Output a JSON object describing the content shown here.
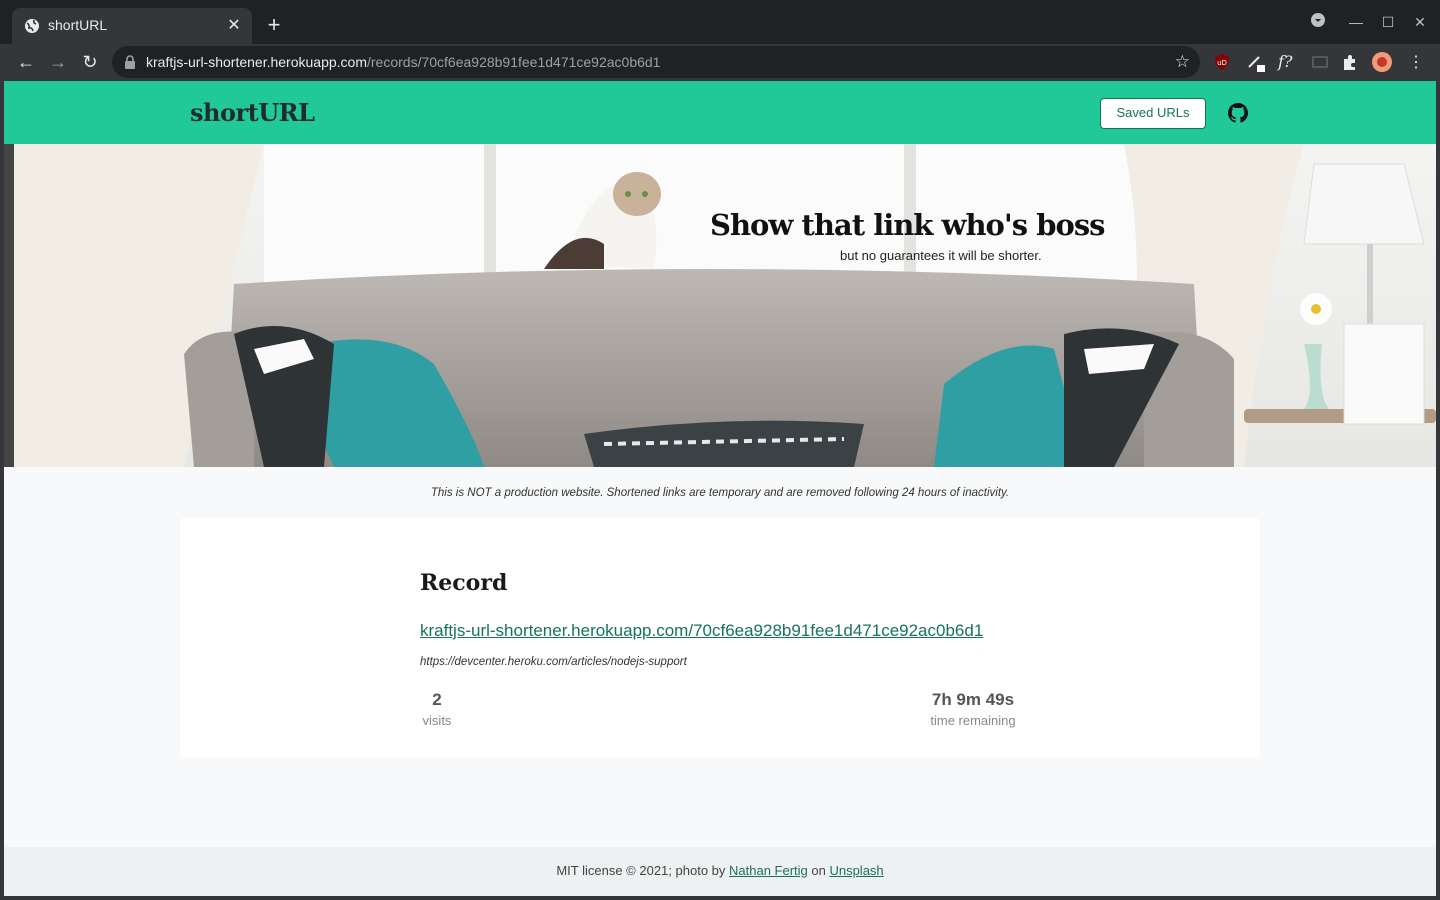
{
  "browser": {
    "tab_title": "shortURL",
    "url_host": "kraftjs-url-shortener.herokuapp.com",
    "url_path": "/records/70cf6ea928b91fee1d471ce92ac0b6d1"
  },
  "header": {
    "brand": "shortURL",
    "saved_label": "Saved URLs"
  },
  "hero": {
    "title": "Show that link who's boss",
    "subtitle": "but no guarantees it will be shorter."
  },
  "notice": "This is NOT a production website. Shortened links are temporary and are removed following 24 hours of inactivity.",
  "record": {
    "heading": "Record",
    "short_url": "kraftjs-url-shortener.herokuapp.com/70cf6ea928b91fee1d471ce92ac0b6d1",
    "original_url": "https://devcenter.heroku.com/articles/nodejs-support",
    "visits": "2",
    "visits_label": "visits",
    "time_remaining": "7h 9m 49s",
    "time_label": "time remaining"
  },
  "footer": {
    "prefix": "MIT license © 2021; photo by ",
    "photographer": "Nathan Fertig",
    "middle": " on ",
    "source": "Unsplash"
  },
  "colors": {
    "accent": "#20c997",
    "link": "#16735a"
  }
}
